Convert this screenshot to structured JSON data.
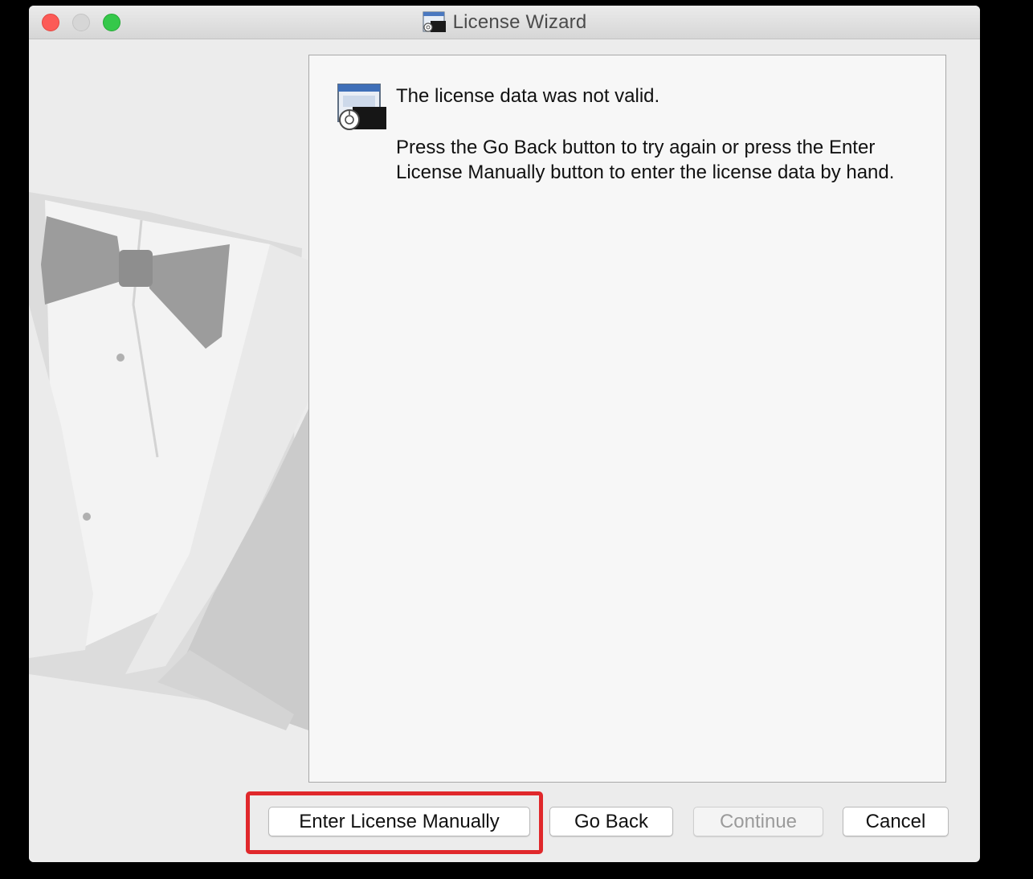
{
  "window": {
    "title": "License Wizard",
    "title_icon": "wizard-window-icon"
  },
  "titlebar": {
    "buttons": [
      "close",
      "minimize",
      "zoom"
    ]
  },
  "message": {
    "icon": "license-wizard-icon",
    "heading": "The license data was not valid.",
    "body": "Press the Go Back button to try again or press the Enter License Manually button to enter the license data by hand."
  },
  "buttons": {
    "enter_manually": "Enter License Manually",
    "go_back": "Go Back",
    "continue": "Continue",
    "cancel": "Cancel"
  },
  "annotation": {
    "highlight_color": "#e0282b",
    "highlight_target": "enter-license-manually-button"
  },
  "colors": {
    "close": "#fc5b57",
    "minimize": "#d6d6d6",
    "zoom": "#35c84a"
  }
}
